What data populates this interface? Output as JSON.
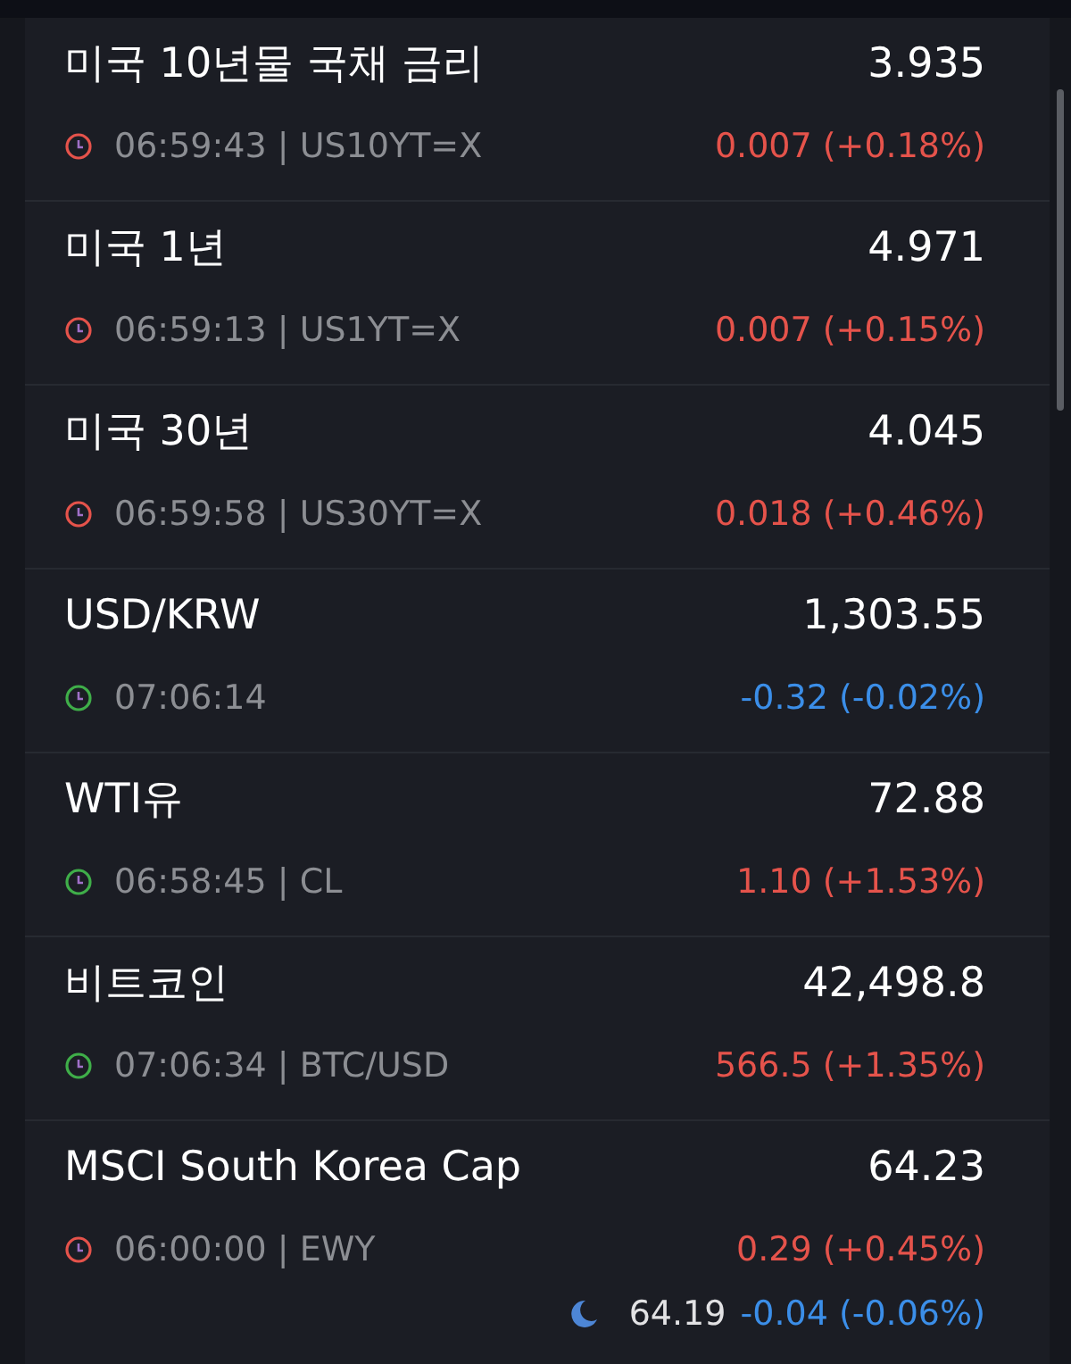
{
  "quotes": [
    {
      "name": "미국 10년물 국채 금리",
      "price": "3.935",
      "market_open": false,
      "time": "06:59:43 | US10YT=X",
      "change": "0.007 (+0.18%)",
      "rising": true
    },
    {
      "name": "미국 1년",
      "price": "4.971",
      "market_open": false,
      "time": "06:59:13 | US1YT=X",
      "change": "0.007 (+0.15%)",
      "rising": true
    },
    {
      "name": "미국 30년",
      "price": "4.045",
      "market_open": false,
      "time": "06:59:58 | US30YT=X",
      "change": "0.018 (+0.46%)",
      "rising": true
    },
    {
      "name": "USD/KRW",
      "price": "1,303.55",
      "market_open": true,
      "time": "07:06:14",
      "change": "-0.32 (-0.02%)",
      "rising": false
    },
    {
      "name": "WTI유",
      "price": "72.88",
      "market_open": true,
      "time": "06:58:45 | CL",
      "change": "1.10 (+1.53%)",
      "rising": true
    },
    {
      "name": "비트코인",
      "price": "42,498.8",
      "market_open": true,
      "time": "07:06:34 | BTC/USD",
      "change": "566.5 (+1.35%)",
      "rising": true
    },
    {
      "name": "MSCI South Korea Cap",
      "price": "64.23",
      "market_open": false,
      "time": "06:00:00 | EWY",
      "change": "0.29 (+0.45%)",
      "rising": true,
      "after_hours": {
        "price": "64.19",
        "change": "-0.04 (-0.06%)",
        "rising": false
      }
    }
  ]
}
